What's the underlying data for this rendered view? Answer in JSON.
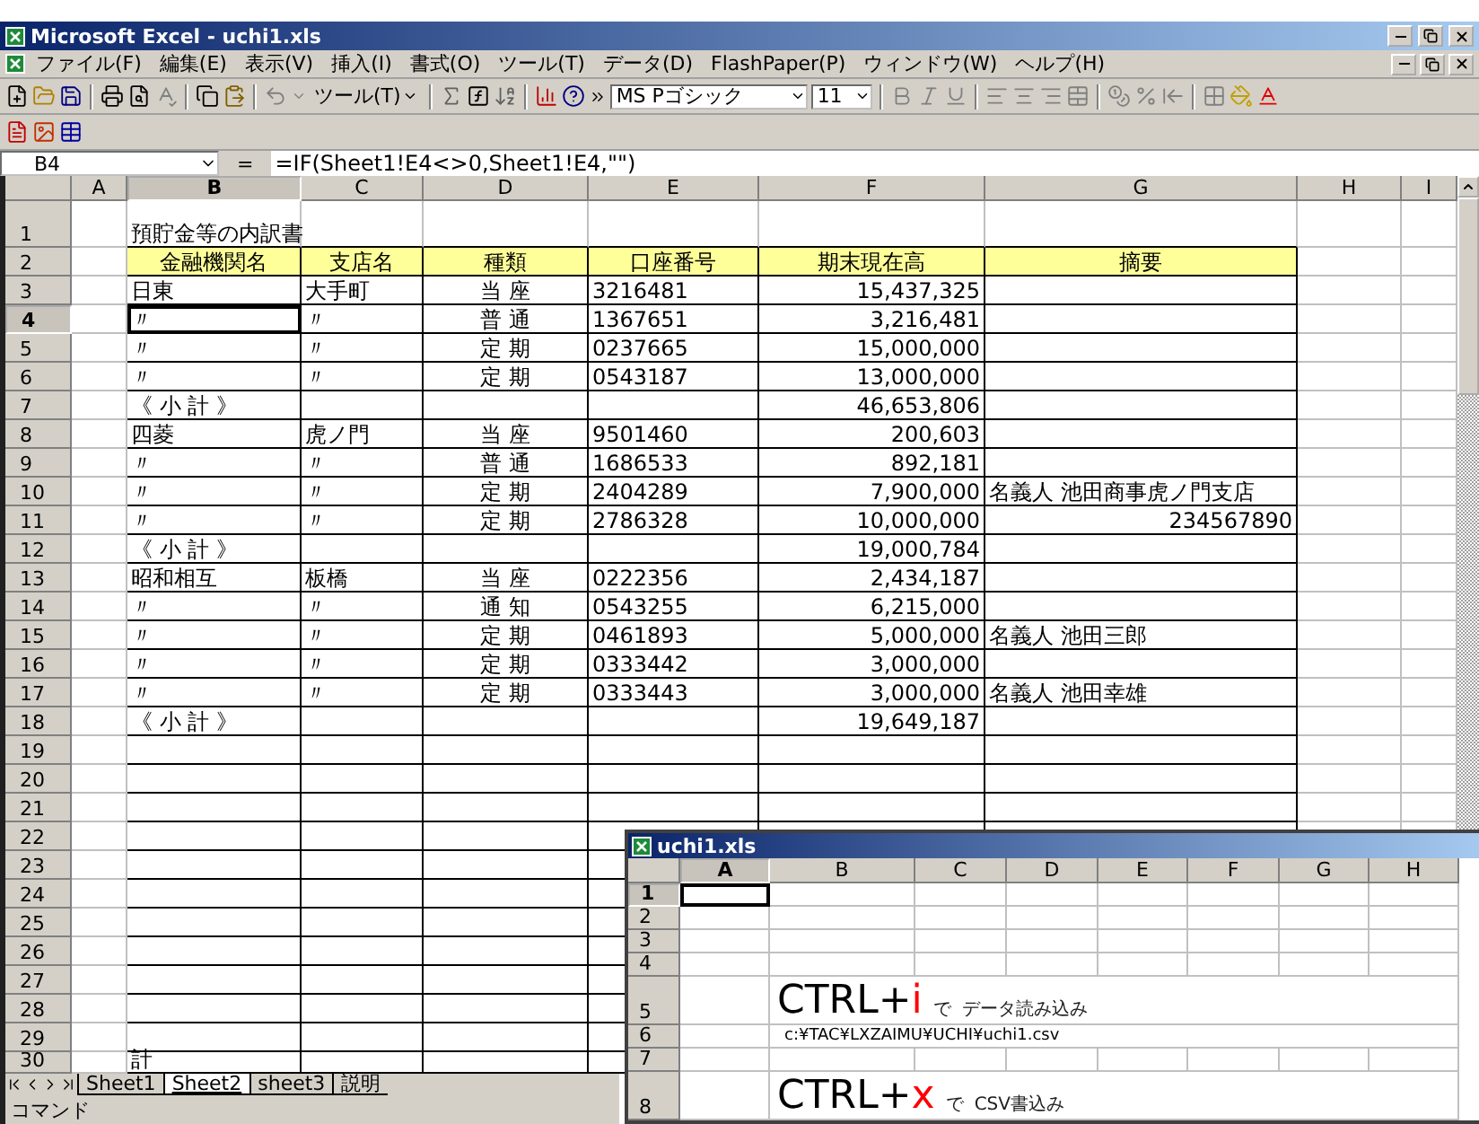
{
  "window": {
    "title": "Microsoft Excel - uchi1.xls"
  },
  "menu": [
    "ファイル(F)",
    "編集(E)",
    "表示(V)",
    "挿入(I)",
    "書式(O)",
    "ツール(T)",
    "データ(D)",
    "FlashPaper(P)",
    "ウィンドウ(W)",
    "ヘルプ(H)"
  ],
  "toolbar": {
    "tools_menu": "ツール(T)",
    "font_name": "MS Pゴシック",
    "font_size": "11"
  },
  "formula_bar": {
    "name_box": "B4",
    "equals": "=",
    "formula": "=IF(Sheet1!E4<>0,Sheet1!E4,\"\")"
  },
  "sheet": {
    "columns": [
      {
        "label": "A",
        "selected": false
      },
      {
        "label": "B",
        "selected": true
      },
      {
        "label": "C",
        "selected": false
      },
      {
        "label": "D",
        "selected": false
      },
      {
        "label": "E",
        "selected": false
      },
      {
        "label": "F",
        "selected": false
      },
      {
        "label": "G",
        "selected": false
      },
      {
        "label": "H",
        "selected": false
      },
      {
        "label": "I",
        "selected": false
      }
    ],
    "rows": [
      {
        "number": "1",
        "selected": false,
        "kind": "title",
        "cells": {
          "b": "預貯金等の内訳書"
        }
      },
      {
        "number": "2",
        "selected": false,
        "kind": "header",
        "cells": {
          "b": "金融機関名",
          "c": "支店名",
          "d": "種類",
          "e": "口座番号",
          "f": "期末現在高",
          "g": "摘要"
        }
      },
      {
        "number": "3",
        "selected": false,
        "kind": "data",
        "cells": {
          "b": "日東",
          "c": "大手町",
          "d": "当 座",
          "e": "3216481",
          "f": "15,437,325"
        }
      },
      {
        "number": "4",
        "selected": true,
        "kind": "data",
        "cells": {
          "b": "〃",
          "c": "〃",
          "d": "普 通",
          "e": "1367651",
          "f": "3,216,481"
        }
      },
      {
        "number": "5",
        "selected": false,
        "kind": "data",
        "cells": {
          "b": "〃",
          "c": "〃",
          "d": "定 期",
          "e": "0237665",
          "f": "15,000,000"
        }
      },
      {
        "number": "6",
        "selected": false,
        "kind": "data",
        "cells": {
          "b": "〃",
          "c": "〃",
          "d": "定 期",
          "e": "0543187",
          "f": "13,000,000"
        }
      },
      {
        "number": "7",
        "selected": false,
        "kind": "data",
        "cells": {
          "b": "《 小  計 》",
          "f": "46,653,806"
        }
      },
      {
        "number": "8",
        "selected": false,
        "kind": "data",
        "cells": {
          "b": "四菱",
          "c": "虎ノ門",
          "d": "当 座",
          "e": "9501460",
          "f": "200,603"
        }
      },
      {
        "number": "9",
        "selected": false,
        "kind": "data",
        "cells": {
          "b": "〃",
          "c": "〃",
          "d": "普 通",
          "e": "1686533",
          "f": "892,181"
        }
      },
      {
        "number": "10",
        "selected": false,
        "kind": "data",
        "cells": {
          "b": "〃",
          "c": "〃",
          "d": "定 期",
          "e": "2404289",
          "f": "7,900,000",
          "g": "名義人 池田商事虎ノ門支店"
        }
      },
      {
        "number": "11",
        "selected": false,
        "kind": "data",
        "cells": {
          "b": "〃",
          "c": "〃",
          "d": "定 期",
          "e": "2786328",
          "f": "10,000,000",
          "g": {
            "text": "234567890",
            "kind": "number"
          }
        }
      },
      {
        "number": "12",
        "selected": false,
        "kind": "data",
        "cells": {
          "b": "《 小  計 》",
          "f": "19,000,784"
        }
      },
      {
        "number": "13",
        "selected": false,
        "kind": "data",
        "cells": {
          "b": "昭和相互",
          "c": "板橋",
          "d": "当 座",
          "e": "0222356",
          "f": "2,434,187"
        }
      },
      {
        "number": "14",
        "selected": false,
        "kind": "data",
        "cells": {
          "b": "〃",
          "c": "〃",
          "d": "通 知",
          "e": "0543255",
          "f": "6,215,000"
        }
      },
      {
        "number": "15",
        "selected": false,
        "kind": "data",
        "cells": {
          "b": "〃",
          "c": "〃",
          "d": "定 期",
          "e": "0461893",
          "f": "5,000,000",
          "g": "名義人 池田三郎"
        }
      },
      {
        "number": "16",
        "selected": false,
        "kind": "data",
        "cells": {
          "b": "〃",
          "c": "〃",
          "d": "定 期",
          "e": "0333442",
          "f": "3,000,000"
        }
      },
      {
        "number": "17",
        "selected": false,
        "kind": "data",
        "cells": {
          "b": "〃",
          "c": "〃",
          "d": "定 期",
          "e": "0333443",
          "f": "3,000,000",
          "g": "名義人 池田幸雄"
        }
      },
      {
        "number": "18",
        "selected": false,
        "kind": "data",
        "cells": {
          "b": "《 小  計 》",
          "f": "19,649,187"
        }
      },
      {
        "number": "19",
        "selected": false,
        "kind": "data",
        "cells": {}
      },
      {
        "number": "20",
        "selected": false,
        "kind": "data",
        "cells": {}
      },
      {
        "number": "21",
        "selected": false,
        "kind": "data",
        "cells": {}
      },
      {
        "number": "22",
        "selected": false,
        "kind": "data",
        "cells": {}
      },
      {
        "number": "23",
        "selected": false,
        "kind": "data",
        "cells": {}
      },
      {
        "number": "24",
        "selected": false,
        "kind": "data",
        "cells": {}
      },
      {
        "number": "25",
        "selected": false,
        "kind": "data",
        "cells": {}
      },
      {
        "number": "26",
        "selected": false,
        "kind": "data",
        "cells": {}
      },
      {
        "number": "27",
        "selected": false,
        "kind": "data",
        "cells": {}
      },
      {
        "number": "28",
        "selected": false,
        "kind": "data",
        "cells": {}
      },
      {
        "number": "29",
        "selected": false,
        "kind": "data",
        "cells": {}
      },
      {
        "number": "30",
        "selected": false,
        "kind": "data",
        "cells": {
          "b": "計"
        }
      }
    ]
  },
  "sheet_tabs": [
    {
      "label": "Sheet1",
      "selected": false
    },
    {
      "label": "Sheet2",
      "selected": true
    },
    {
      "label": "sheet3",
      "selected": false
    },
    {
      "label": "説明",
      "selected": false
    }
  ],
  "status_bar": "コマンド",
  "inner_window": {
    "title": "uchi1.xls",
    "columns": [
      {
        "label": "A",
        "selected": true
      },
      {
        "label": "B",
        "selected": false
      },
      {
        "label": "C",
        "selected": false
      },
      {
        "label": "D",
        "selected": false
      },
      {
        "label": "E",
        "selected": false
      },
      {
        "label": "F",
        "selected": false
      },
      {
        "label": "G",
        "selected": false
      },
      {
        "label": "H",
        "selected": false
      }
    ],
    "rows": [
      {
        "number": "1",
        "selected": true,
        "kind": "plain"
      },
      {
        "number": "2",
        "selected": false,
        "kind": "plain"
      },
      {
        "number": "3",
        "selected": false,
        "kind": "plain"
      },
      {
        "number": "4",
        "selected": false,
        "kind": "plain"
      },
      {
        "number": "5",
        "selected": false,
        "kind": "shortcut",
        "keys": "CTRL+",
        "key": "i",
        "particle": "で",
        "action": "データ読み込み"
      },
      {
        "number": "6",
        "selected": false,
        "kind": "path",
        "text": "c:¥TAC¥LXZAIMU¥UCHI¥uchi1.csv"
      },
      {
        "number": "7",
        "selected": false,
        "kind": "plain"
      },
      {
        "number": "8",
        "selected": false,
        "kind": "shortcut",
        "keys": "CTRL+",
        "key": "x",
        "particle": "で",
        "action": "CSV書込み"
      }
    ]
  }
}
